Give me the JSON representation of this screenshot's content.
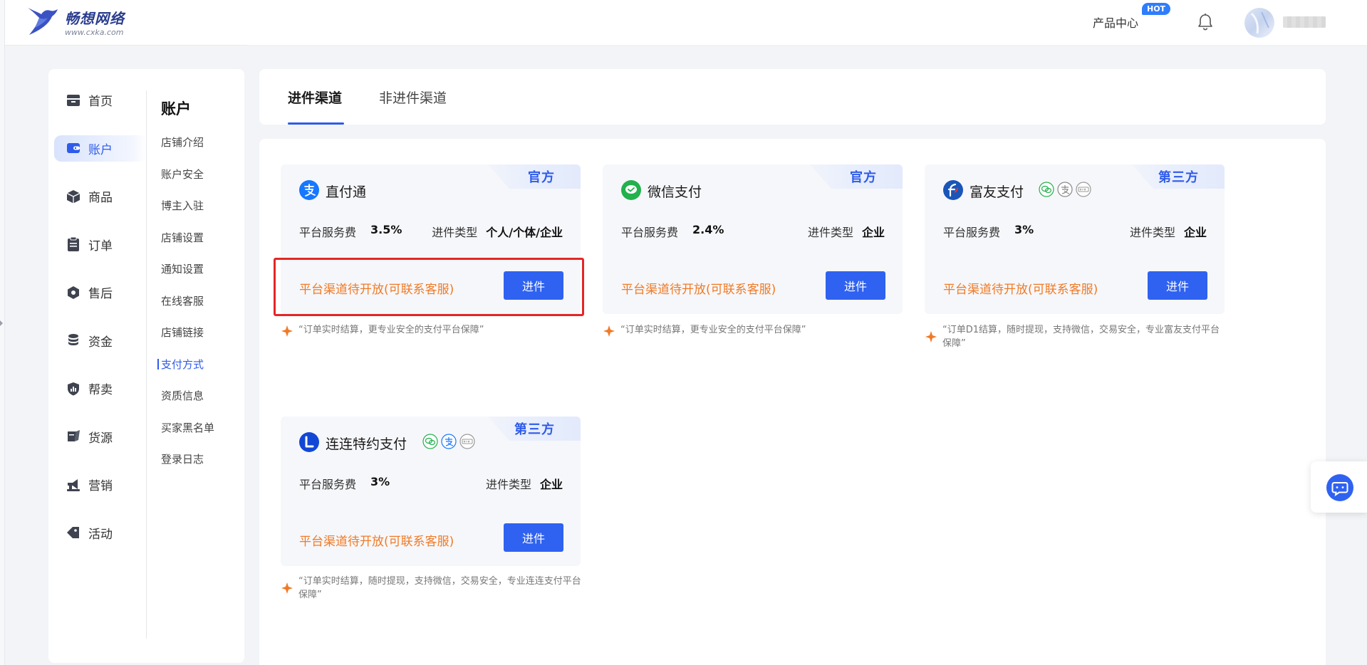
{
  "header": {
    "brand_name": "畅想网络",
    "brand_url": "www.cxka.com",
    "product_center_label": "产品中心",
    "hot_badge": "HOT",
    "accent_color": "#2f5bea"
  },
  "sidebar": {
    "primary": [
      {
        "label": "首页",
        "icon": "store-icon"
      },
      {
        "label": "账户",
        "icon": "wallet-icon",
        "active": true
      },
      {
        "label": "商品",
        "icon": "box-icon"
      },
      {
        "label": "订单",
        "icon": "clipboard-icon"
      },
      {
        "label": "售后",
        "icon": "hexagon-icon"
      },
      {
        "label": "资金",
        "icon": "coins-icon"
      },
      {
        "label": "帮卖",
        "icon": "chart-shield-icon"
      },
      {
        "label": "货源",
        "icon": "supply-icon"
      },
      {
        "label": "营销",
        "icon": "megaphone-icon"
      },
      {
        "label": "活动",
        "icon": "tag-icon"
      }
    ],
    "section_title": "账户",
    "sub_items": [
      "店铺介绍",
      "账户安全",
      "博主入驻",
      "店铺设置",
      "通知设置",
      "在线客服",
      "店铺链接",
      "支付方式",
      "资质信息",
      "买家黑名单",
      "登录日志"
    ],
    "active_sub_item": "支付方式"
  },
  "tabs": [
    {
      "label": "进件渠道",
      "active": true
    },
    {
      "label": "非进件渠道",
      "active": false
    }
  ],
  "cards": [
    {
      "name": "直付通",
      "tag": "官方",
      "logo": "alipay-icon",
      "fee_label": "平台服务费",
      "fee_value": "3.5%",
      "type_label": "进件类型",
      "type_value": "个人/个体/企业",
      "status": "平台渠道待开放(可联系客服)",
      "button_label": "进件",
      "note": "“订单实时结算，更专业安全的支付平台保障”",
      "highlighted": true
    },
    {
      "name": "微信支付",
      "tag": "官方",
      "logo": "wechat-pay-icon",
      "fee_label": "平台服务费",
      "fee_value": "2.4%",
      "type_label": "进件类型",
      "type_value": "企业",
      "status": "平台渠道待开放(可联系客服)",
      "button_label": "进件",
      "note": "“订单实时结算，更专业安全的支付平台保障”"
    },
    {
      "name": "富友支付",
      "tag": "第三方",
      "logo": "fuiou-icon",
      "mini_icons": [
        "wechat-mini-icon",
        "alipay-mini-icon",
        "unionpay-mini-icon"
      ],
      "fee_label": "平台服务费",
      "fee_value": "3%",
      "type_label": "进件类型",
      "type_value": "企业",
      "status": "平台渠道待开放(可联系客服)",
      "button_label": "进件",
      "note": "“订单D1结算，随时提现，支持微信，交易安全，专业富友支付平台保障”"
    },
    {
      "name": "连连特约支付",
      "tag": "第三方",
      "logo": "lianlian-icon",
      "mini_icons": [
        "wechat-mini-icon",
        "alipay-mini-icon",
        "unionpay-mini-icon"
      ],
      "fee_label": "平台服务费",
      "fee_value": "3%",
      "type_label": "进件类型",
      "type_value": "企业",
      "status": "平台渠道待开放(可联系客服)",
      "button_label": "进件",
      "note": "“订单实时结算，随时提现，支持微信，交易安全，专业连连支付平台保障”"
    }
  ]
}
